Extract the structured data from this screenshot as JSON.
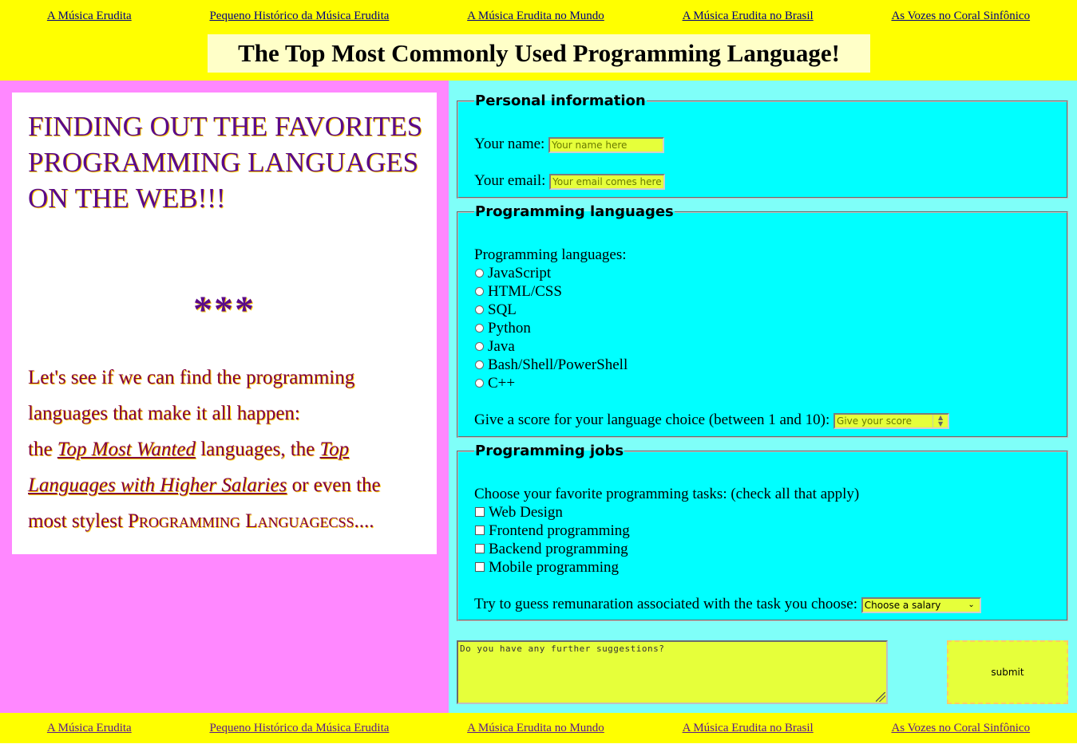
{
  "nav": {
    "links": [
      "A Música Erudita",
      "Pequeno Histórico da Música Erudita",
      "A Música Erudita no Mundo",
      "A Música Erudita no Brasil",
      "As Vozes no Coral Sinfônico"
    ]
  },
  "header": {
    "title": "The Top Most Commonly Used Programming Language!"
  },
  "left": {
    "headline": "FINDING OUT THE FAVORITES PROGRAMMING LANGUAGES ON THE WEB!!!",
    "stars": "***",
    "intro_1": "Let's see if we can find the programming languages that make it all happen:",
    "intro_2": "the",
    "link_top_wanted": "Top Most Wanted",
    "intro_3": "languages, the",
    "link_salaries": "Top Languages with Higher Salaries",
    "intro_4": "or even the most stylest",
    "smallcaps": "Programming Languagecss",
    "ellipsis": "...."
  },
  "personal": {
    "legend": "Personal information",
    "name_label": "Your name:",
    "name_placeholder": "Your name here",
    "email_label": "Your email:",
    "email_placeholder": "Your email comes here"
  },
  "languages": {
    "legend": "Programming languages",
    "label": "Programming languages:",
    "options": [
      "JavaScript",
      "HTML/CSS",
      "SQL",
      "Python",
      "Java",
      "Bash/Shell/PowerShell",
      "C++"
    ],
    "score_label": "Give a score for your language choice (between 1 and 10):",
    "score_placeholder": "Give your score"
  },
  "jobs": {
    "legend": "Programming jobs",
    "label": "Choose your favorite programming tasks: (check all that apply)",
    "tasks": [
      "Web Design",
      "Frontend programming",
      "Backend programming",
      "Mobile programming"
    ],
    "salary_label": "Try to guess remunaration associated with the task you choose:",
    "salary_selected": "Choose a salary"
  },
  "suggestions": {
    "placeholder": "Do you have any further suggestions?"
  },
  "submit_label": "submit",
  "colors": {
    "nav_bg": "#ffff00",
    "left_bg": "#ff88ff",
    "right_bg": "#7ffff9",
    "fieldset_bg": "#00ffff",
    "input_bg": "#e6ff3a",
    "headline": "#5a0a8a"
  }
}
